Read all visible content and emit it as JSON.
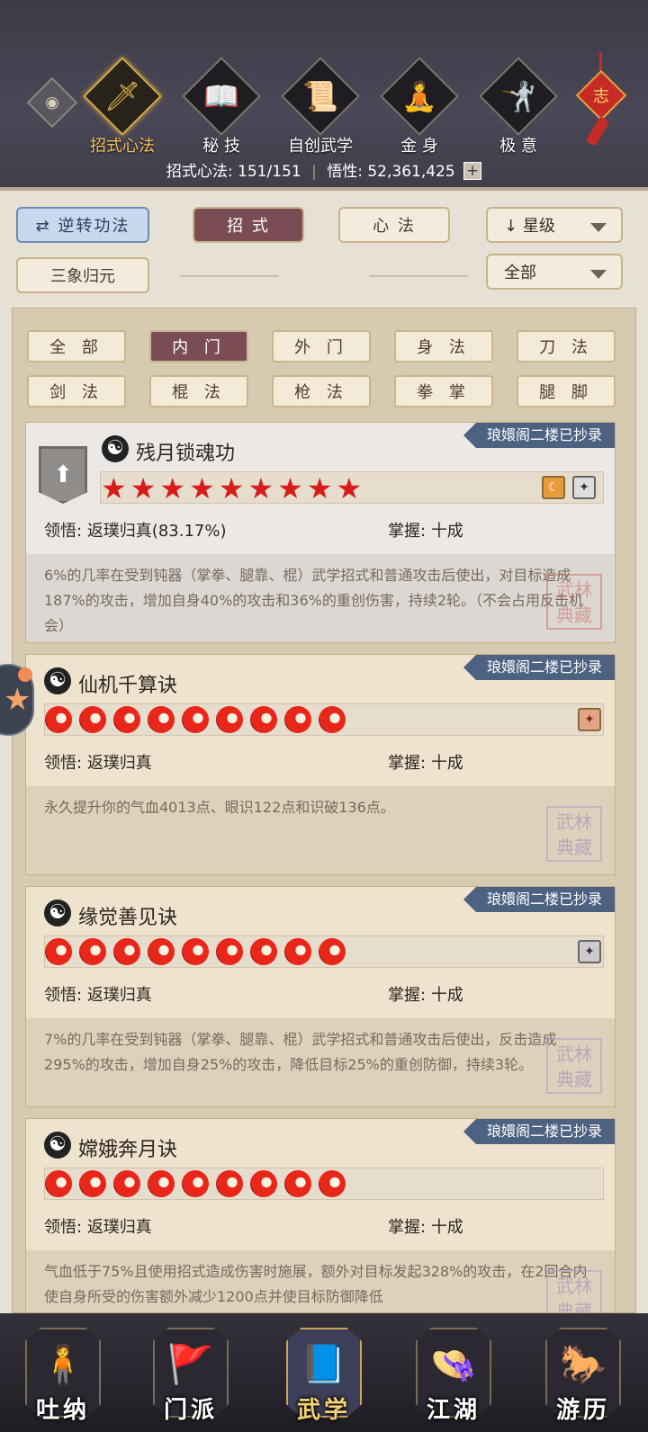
{
  "header": {
    "tabs": [
      {
        "label": "招式心法",
        "icon": "sword-icon",
        "active": true
      },
      {
        "label": "秘 技",
        "icon": "book-icon",
        "active": false
      },
      {
        "label": "自创武学",
        "icon": "scroll-icon",
        "active": false
      },
      {
        "label": "金 身",
        "icon": "meditation-icon",
        "active": false
      },
      {
        "label": "极 意",
        "icon": "martial-pose-icon",
        "active": false
      }
    ],
    "charm_label": "志",
    "stats": {
      "moves_label": "招式心法:",
      "moves_value": "151/151",
      "insight_label": "悟性:",
      "insight_value": "52,361,425",
      "plus": "+"
    }
  },
  "toolbar": {
    "reverse_button": "逆转功法",
    "moves_button": "招 式",
    "mind_button": "心 法",
    "sort_select": "星级",
    "sanxiang_button": "三象归元",
    "category_select": "全部"
  },
  "filters": [
    "全 部",
    "内 门",
    "外 门",
    "身 法",
    "刀 法",
    "剑 法",
    "棍 法",
    "枪 法",
    "拳 掌",
    "腿 脚"
  ],
  "filter_active_index": 1,
  "cards": [
    {
      "ribbon": "琅嬛阁二楼已抄录",
      "title": "残月锁魂功",
      "star_count": 9,
      "comprehension_label": "领悟:",
      "comprehension_value": "返璞归真(83.17%)",
      "mastery_label": "掌握:",
      "mastery_value": "十成",
      "description": "6%的几率在受到钝器（掌拳、腿靠、棍）武学招式和普通攻击后使出，对目标造成187%的攻击，增加自身40%的攻击和36%的重创伤害，持续2轮。（不会占用反击机会）",
      "seal": "武林\n典藏"
    },
    {
      "ribbon": "琅嬛阁二楼已抄录",
      "title": "仙机千算诀",
      "star_count": 9,
      "comprehension_label": "领悟:",
      "comprehension_value": "返璞归真",
      "mastery_label": "掌握:",
      "mastery_value": "十成",
      "description": "永久提升你的气血4013点、眼识122点和识破136点。",
      "seal": "武林\n典藏"
    },
    {
      "ribbon": "琅嬛阁二楼已抄录",
      "title": "缘觉善见诀",
      "star_count": 9,
      "comprehension_label": "领悟:",
      "comprehension_value": "返璞归真",
      "mastery_label": "掌握:",
      "mastery_value": "十成",
      "description": "7%的几率在受到钝器（掌拳、腿靠、棍）武学招式和普通攻击后使出，反击造成295%的攻击，增加自身25%的攻击，降低目标25%的重创防御，持续3轮。",
      "seal": "武林\n典藏"
    },
    {
      "ribbon": "琅嬛阁二楼已抄录",
      "title": "嫦娥奔月诀",
      "star_count": 9,
      "comprehension_label": "领悟:",
      "comprehension_value": "返璞归真",
      "mastery_label": "掌握:",
      "mastery_value": "十成",
      "description": "气血低于75%且使用招式造成伤害时施展，额外对目标发起328%的攻击，在2回合内使自身所受的伤害额外减少1200点并使目标防御降低",
      "seal": "武林\n典藏"
    }
  ],
  "bottom_nav": [
    {
      "label": "吐纳",
      "icon": "figure-icon",
      "active": false
    },
    {
      "label": "门派",
      "icon": "banner-icon",
      "active": false
    },
    {
      "label": "武学",
      "icon": "manual-icon",
      "active": true
    },
    {
      "label": "江湖",
      "icon": "straw-hat-icon",
      "active": false
    },
    {
      "label": "游历",
      "icon": "horse-icon",
      "active": false
    }
  ],
  "colors": {
    "accent_gold": "#e6b84a",
    "active_pill": "#7a4d55",
    "ribbon_blue": "#4c6280",
    "star_red": "#d91b1b"
  }
}
